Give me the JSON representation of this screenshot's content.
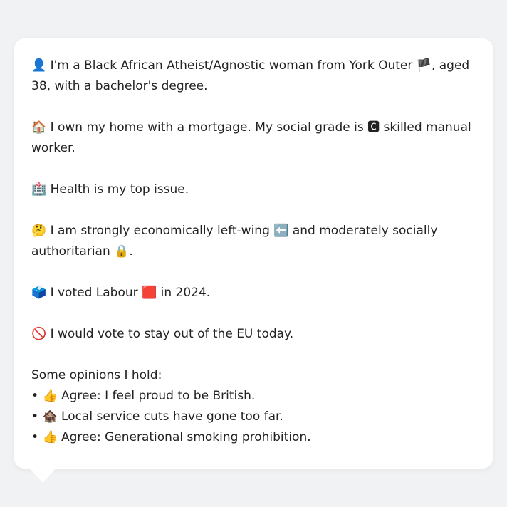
{
  "message": {
    "identity": {
      "icon": "👤",
      "text_a": "I'm a Black African Atheist/Agnostic woman from York Outer ",
      "flag": "🏴",
      "text_b": ", aged 38, with a bachelor's degree."
    },
    "home": {
      "icon": "🏠",
      "text_a": "I own my home with a mortgage. My social grade is ",
      "grade_icon": "🅲",
      "text_b": " skilled manual worker."
    },
    "issue": {
      "icon": "🏥",
      "text": "Health is my top issue."
    },
    "politics": {
      "icon": "🤔",
      "text_a": "I am strongly economically left-wing ",
      "left_icon": "⬅️",
      "text_b": " and moderately socially authoritarian ",
      "lock_icon": "🔒",
      "text_c": "."
    },
    "vote": {
      "icon": "🗳️",
      "text_a": "I voted Labour ",
      "party_icon": "🟥",
      "text_b": " in 2024."
    },
    "eu": {
      "icon": "🚫",
      "text": "I would vote to stay out of the EU today."
    },
    "opinions": {
      "heading": "Some opinions I hold:",
      "items": [
        {
          "bullet": "•",
          "icon": "👍",
          "text": "Agree: I feel proud to be British."
        },
        {
          "bullet": "•",
          "icon": "🏚️",
          "text": "Local service cuts have gone too far."
        },
        {
          "bullet": "•",
          "icon": "👍",
          "text": "Agree: Generational smoking prohibition."
        }
      ]
    }
  }
}
